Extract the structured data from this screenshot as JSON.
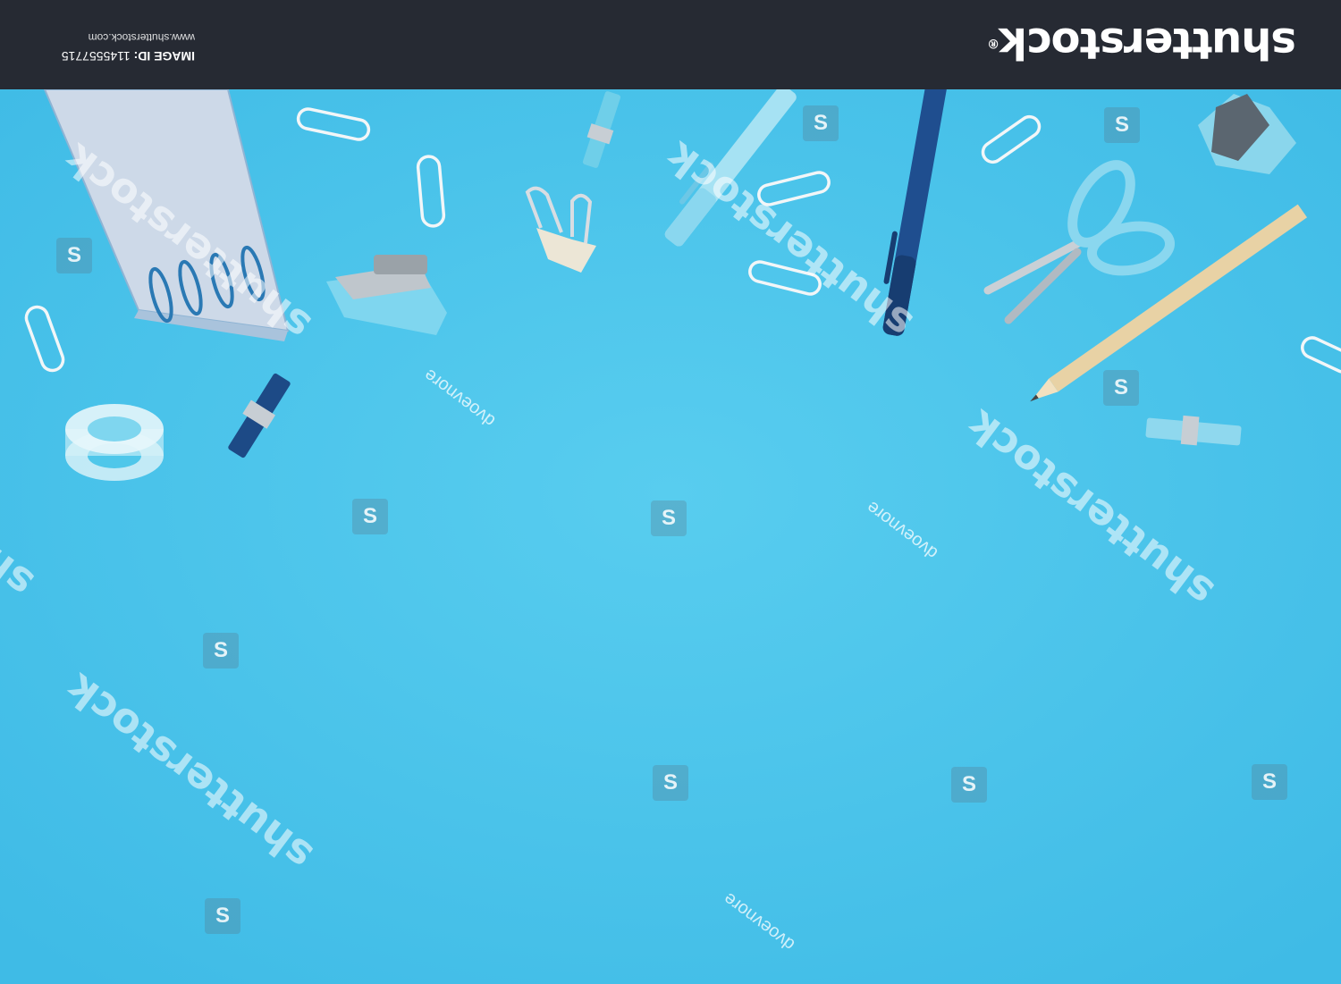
{
  "banner": {
    "brand": "shutterstock",
    "brand_mark": "®",
    "image_id_label": "IMAGE ID:",
    "image_id": "1145557715",
    "site_url": "www.shutterstock.com"
  },
  "watermark": {
    "brand_text": "shutterstock",
    "author": "dvoevnore",
    "logo_glyph": "S"
  },
  "colors": {
    "background": "#4fc7ea",
    "banner": "#262a33",
    "light_blue_items": "#8fdcf0",
    "dark_blue_items": "#1f4e8f"
  },
  "photo": {
    "orientation": "upside-down",
    "items": [
      "spiral-notepad",
      "paper-clip",
      "binder-clip",
      "stapler",
      "clothes-peg",
      "pen",
      "marker",
      "scissors",
      "pencil",
      "staple-remover",
      "tape-roll"
    ]
  }
}
